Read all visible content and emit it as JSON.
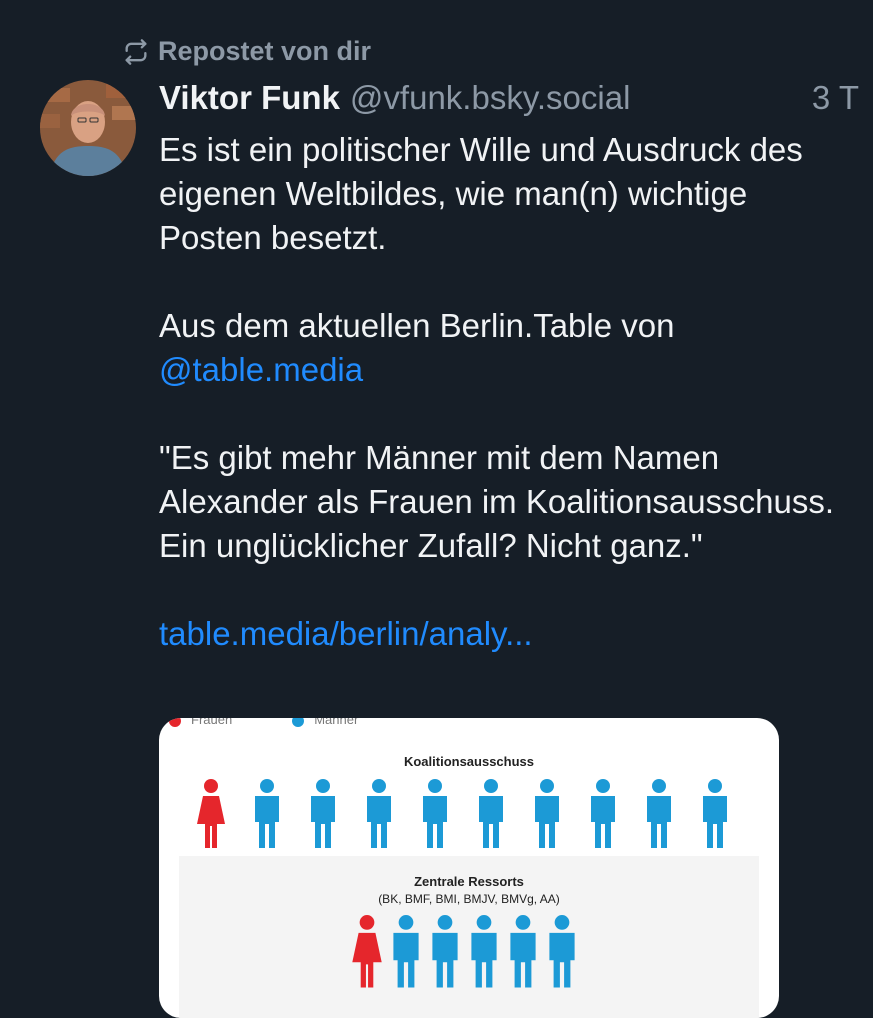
{
  "repost": {
    "label": "Repostet von dir",
    "icon": "repost-icon"
  },
  "post": {
    "author": "Viktor Funk",
    "handle": "@vfunk.bsky.social",
    "time": "3 T",
    "text1": "Es ist ein politischer Wille und Ausdruck des eigenen Weltbildes, wie man(n) wichtige Posten besetzt.",
    "text2": "Aus dem aktuellen Berlin.Table von",
    "mention": "@table.media",
    "text3": "\"Es gibt mehr Männer mit dem Namen Alexander als Frauen im Koalitionsausschuss. Ein unglücklicher Zufall? Nicht ganz.\"",
    "link": "table.media/berlin/analy..."
  },
  "embed": {
    "legend": [
      "Frauen",
      "Männer"
    ],
    "colors": {
      "women": "#e5262c",
      "men": "#1c9ad6"
    },
    "sections": [
      {
        "title": "Koalitionsausschuss",
        "subtitle": "",
        "women": 1,
        "men": 9
      },
      {
        "title": "Zentrale Ressorts",
        "subtitle": "(BK, BMF, BMI, BMJV, BMVg, AA)",
        "women": 1,
        "men": 5
      }
    ]
  }
}
